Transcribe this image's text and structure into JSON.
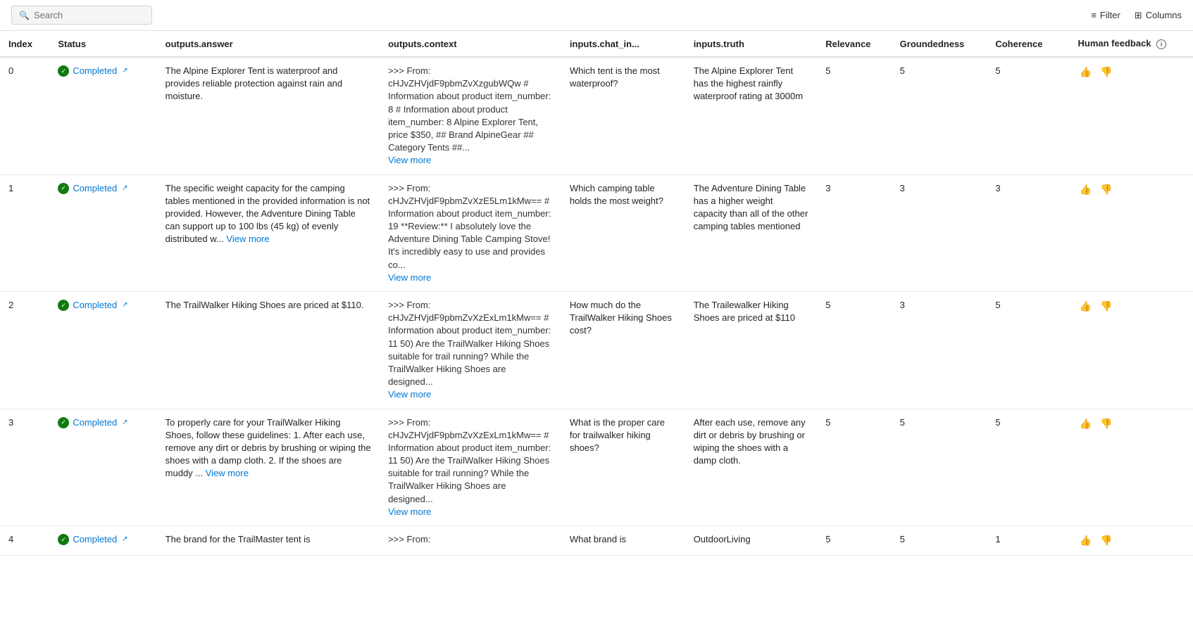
{
  "toolbar": {
    "search_placeholder": "Search",
    "filter_label": "Filter",
    "columns_label": "Columns"
  },
  "table": {
    "headers": [
      {
        "id": "index",
        "label": "Index"
      },
      {
        "id": "status",
        "label": "Status"
      },
      {
        "id": "outputs_answer",
        "label": "outputs.answer"
      },
      {
        "id": "outputs_context",
        "label": "outputs.context"
      },
      {
        "id": "inputs_chat_in",
        "label": "inputs.chat_in..."
      },
      {
        "id": "inputs_truth",
        "label": "inputs.truth"
      },
      {
        "id": "relevance",
        "label": "Relevance"
      },
      {
        "id": "groundedness",
        "label": "Groundedness"
      },
      {
        "id": "coherence",
        "label": "Coherence"
      },
      {
        "id": "human_feedback",
        "label": "Human feedback"
      }
    ],
    "rows": [
      {
        "index": "0",
        "status": "Completed",
        "answer": "The Alpine Explorer Tent is waterproof and provides reliable protection against rain and moisture.",
        "context": ">>> From: cHJvZHVjdF9pbmZvXzgubWQw # Information about product item_number: 8 # Information about product item_number: 8 Alpine Explorer Tent, price $350, ## Brand AlpineGear ## Category Tents ##...",
        "context_has_more": true,
        "chat_in": "Which tent is the most waterproof?",
        "truth": "The Alpine Explorer Tent has the highest rainfly waterproof rating at 3000m",
        "relevance": "5",
        "groundedness": "5",
        "coherence": "5"
      },
      {
        "index": "1",
        "status": "Completed",
        "answer": "The specific weight capacity for the camping tables mentioned in the provided information is not provided. However, the Adventure Dining Table can support up to 100 lbs (45 kg) of evenly distributed w...",
        "answer_has_more": true,
        "answer_more_text": "View more",
        "context": ">>> From: cHJvZHVjdF9pbmZvXzE5Lm1kMw== # Information about product item_number: 19 **Review:** I absolutely love the Adventure Dining Table Camping Stove! It's incredibly easy to use and provides co...",
        "context_has_more": true,
        "chat_in": "Which camping table holds the most weight?",
        "truth": "The Adventure Dining Table has a higher weight capacity than all of the other camping tables mentioned",
        "relevance": "3",
        "groundedness": "3",
        "coherence": "3"
      },
      {
        "index": "2",
        "status": "Completed",
        "answer": "The TrailWalker Hiking Shoes are priced at $110.",
        "context": ">>> From: cHJvZHVjdF9pbmZvXzExLm1kMw== # Information about product item_number: 11 50) Are the TrailWalker Hiking Shoes suitable for trail running? While the TrailWalker Hiking Shoes are designed...",
        "context_has_more": true,
        "chat_in": "How much do the TrailWalker Hiking Shoes cost?",
        "truth": "The Trailewalker Hiking Shoes are priced at $110",
        "relevance": "5",
        "groundedness": "3",
        "coherence": "5"
      },
      {
        "index": "3",
        "status": "Completed",
        "answer": "To properly care for your TrailWalker Hiking Shoes, follow these guidelines: 1. After each use, remove any dirt or debris by brushing or wiping the shoes with a damp cloth. 2. If the shoes are muddy ...",
        "answer_has_more": true,
        "answer_more_text": "View more",
        "context": ">>> From: cHJvZHVjdF9pbmZvXzExLm1kMw== # Information about product item_number: 11 50) Are the TrailWalker Hiking Shoes suitable for trail running? While the TrailWalker Hiking Shoes are designed...",
        "context_has_more": true,
        "chat_in": "What is the proper care for trailwalker hiking shoes?",
        "truth": "After each use, remove any dirt or debris by brushing or wiping the shoes with a damp cloth.",
        "relevance": "5",
        "groundedness": "5",
        "coherence": "5"
      },
      {
        "index": "4",
        "status": "Completed",
        "answer": "The brand for the TrailMaster tent is",
        "context": ">>> From:",
        "chat_in": "What brand is",
        "truth": "OutdoorLiving",
        "relevance": "5",
        "groundedness": "5",
        "coherence": "1"
      }
    ]
  }
}
